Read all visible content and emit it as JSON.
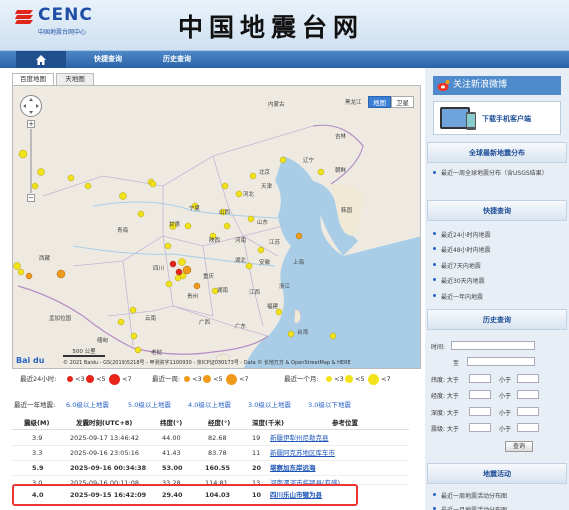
{
  "header": {
    "logo_text": "CENC",
    "logo_subtitle": "中国地震台网中心",
    "site_title": "中国地震台网"
  },
  "nav": {
    "items": [
      "快捷查询",
      "历史查询"
    ]
  },
  "map_tabs": [
    "百度地图",
    "天地图"
  ],
  "map": {
    "type_buttons": [
      "地图",
      "卫星"
    ],
    "scale_label": "500 公里",
    "copyright": "© 2021 Baidu - GS(2019)5218号 - 甲测资字1100930 - 京ICP证030173号 - Data © 长地万方 & OpenStreetMap & HERE",
    "brand": "Bai du",
    "labels": {
      "neimenggu": "内蒙古",
      "heilongjiang": "黑龙江",
      "jilin": "吉林",
      "liaoning": "辽宁",
      "beijing": "北京",
      "tianjin": "天津",
      "hebei": "河北",
      "shanxi": "山西",
      "shandong": "山东",
      "chaoxian": "朝鲜",
      "hanguo": "韩国",
      "ningxia": "宁夏",
      "gansu": "甘肃",
      "shaanxi": "陕西",
      "henan": "河南",
      "jiangsu": "江苏",
      "qinghai": "青海",
      "xizang": "西藏",
      "sichuan": "四川",
      "chongqing": "重庆",
      "hubei": "湖北",
      "anhui": "安徽",
      "shanghai": "上海",
      "zhejiang": "浙江",
      "guizhou": "贵州",
      "hunan": "湖南",
      "jiangxi": "江西",
      "fujian": "福建",
      "yunnan": "云南",
      "guangxi": "广西",
      "guangdong": "广东",
      "taiwan": "台湾",
      "mengjiala": "孟加拉国",
      "miandian": "缅甸",
      "laowo": "老挝"
    }
  },
  "legend": {
    "day_label": "最近24小时:",
    "week_label": "最近一周:",
    "month_label": "最近一个月:",
    "mag_lt3": "<3",
    "mag_lt5": "<5",
    "mag_lt7": "<7",
    "colors": {
      "day": "#e8241b",
      "week": "#f09a1c",
      "month": "#f2e21a"
    }
  },
  "year_section": {
    "title": "最近一年地震:",
    "filters": [
      "6.0级以上地震",
      "5.0级以上地震",
      "4.0级以上地震",
      "3.0级以上地震",
      "3.0级以下地震"
    ]
  },
  "table": {
    "headers": [
      "震级(M)",
      "发震时刻(UTC+8)",
      "纬度(°)",
      "经度(°)",
      "深度(千米)",
      "参考位置"
    ],
    "rows": [
      {
        "mag": "3.9",
        "time": "2025-09-17 13:46:42",
        "lat": "44.00",
        "lon": "82.68",
        "depth": "19",
        "loc": "新疆伊犁州尼勒克县"
      },
      {
        "mag": "3.3",
        "time": "2025-09-16 23:05:16",
        "lat": "41.43",
        "lon": "83.78",
        "depth": "11",
        "loc": "新疆阿克苏地区库车市"
      },
      {
        "mag": "5.9",
        "time": "2025-09-16 00:34:38",
        "lat": "53.00",
        "lon": "160.55",
        "depth": "20",
        "loc": "堪察加东岸远海"
      },
      {
        "mag": "3.0",
        "time": "2025-09-16 00:11:08",
        "lat": "33.28",
        "lon": "114.81",
        "depth": "13",
        "loc": "河南漯河市临颍县(有感)"
      },
      {
        "mag": "4.0",
        "time": "2025-09-15 16:42:09",
        "lat": "29.40",
        "lon": "104.03",
        "depth": "10",
        "loc": "四川乐山市犍为县"
      }
    ]
  },
  "sidebar": {
    "weibo": "关注新浪微博",
    "client": "下载手机客户端",
    "global_title": "全球最新地震分布",
    "global_items": [
      "最近一周全球地震分布（含USGS结果）"
    ],
    "quick_title": "快捷查询",
    "quick_items": [
      "最近24小时内地震",
      "最近48小时内地震",
      "最近7天内地震",
      "最近30天内地震",
      "最近一年内地震"
    ],
    "history_title": "历史查询",
    "form": {
      "time_label": "时间:",
      "to_label": "至",
      "lat_label": "纬度: 大于",
      "lon_label": "经度: 大于",
      "depth_label": "深度: 大于",
      "mag_label": "震级: 大于",
      "less_label": "小于",
      "query_button": "查询"
    },
    "activity_title": "地震活动",
    "activity_items": [
      "最近一周地震活动分布图",
      "最近一月地震活动分布图"
    ]
  }
}
